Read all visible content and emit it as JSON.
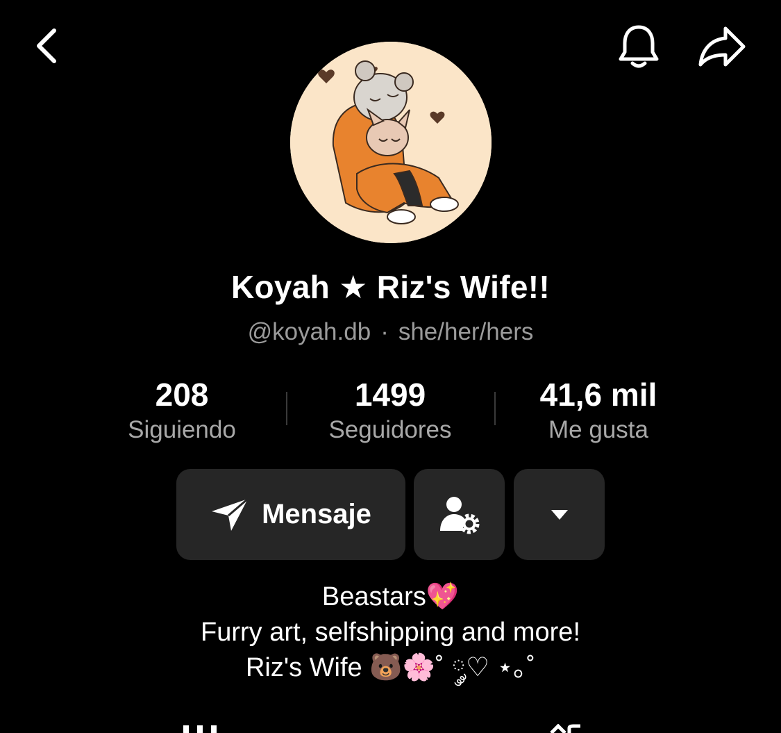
{
  "nav": {
    "back_icon": "chevron-left-icon",
    "notifications_icon": "bell-icon",
    "share_icon": "share-arrow-icon"
  },
  "profile": {
    "display_name": "Koyah ★ Riz's Wife!!",
    "handle": "@koyah.db",
    "separator": "·",
    "pronouns": "she/her/hers",
    "avatar": "profile-illustration"
  },
  "stats": {
    "following": {
      "value": "208",
      "label": "Siguiendo"
    },
    "followers": {
      "value": "1499",
      "label": "Seguidores"
    },
    "likes": {
      "value": "41,6 mil",
      "label": "Me gusta"
    }
  },
  "actions": {
    "message_label": "Mensaje",
    "message_icon": "send-icon",
    "profile_settings_icon": "user-gear-icon",
    "more_icon": "caret-down-icon"
  },
  "bio": {
    "line1": "Beastars💖",
    "line2": "Furry art, selfshipping and more!",
    "line3": "Riz's Wife 🐻🌸˚ ༘♡ ⋆｡˚"
  },
  "colors": {
    "background": "#000000",
    "text_primary": "#ffffff",
    "text_secondary": "#9b9b9b",
    "button_bg": "#262626",
    "avatar_bg": "#fbe5c8"
  }
}
